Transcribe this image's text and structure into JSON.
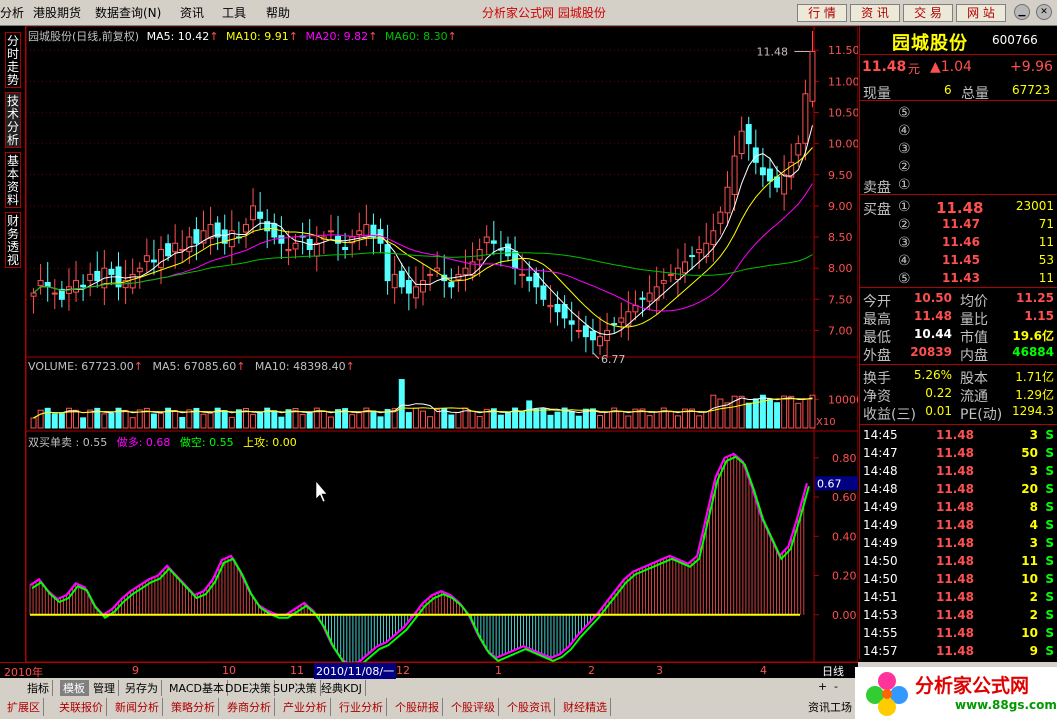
{
  "menu": {
    "items": [
      "分析",
      "港股期货",
      "数据查询(N)",
      "资讯",
      "工具",
      "帮助"
    ],
    "title": "分析家公式网  园城股份",
    "buttons": [
      "行 情",
      "资 讯",
      "交 易",
      "网 站"
    ]
  },
  "left_tabs": [
    "分时走势",
    "技术分析",
    "基本资料",
    "财务透视"
  ],
  "main_chart": {
    "header_name": "园城股份(日线,前复权)",
    "ma5": "MA5: 10.42",
    "ma10": "MA10: 9.91",
    "ma20": "MA20: 9.82",
    "ma60": "MA60: 8.30",
    "high_label": "11.48",
    "low_label": "6.77",
    "y_ticks": [
      "11.50",
      "11.00",
      "10.50",
      "10.00",
      "9.50",
      "9.00",
      "8.50",
      "8.00",
      "7.50",
      "7.00"
    ]
  },
  "volume_chart": {
    "volume": "VOLUME: 67723.00",
    "ma5": "MA5: 67085.60",
    "ma10": "MA10: 48398.40",
    "y_tick": "10000",
    "unit": "X10"
  },
  "indicator_chart": {
    "name": "双买单卖 : 0.55",
    "more": "做多: 0.68",
    "short": "做空: 0.55",
    "up": "上攻: 0.00",
    "y_ticks": [
      "0.80",
      "0.60",
      "0.40",
      "0.20",
      "0.00"
    ],
    "current": "0.67"
  },
  "chart_data": {
    "type": "candlestick",
    "title": "园城股份(日线,前复权)",
    "x_labels": [
      "2010年",
      "9",
      "10",
      "11",
      "2010/11/08/一",
      "12",
      "1",
      "2",
      "3",
      "4"
    ],
    "ylim": [
      6.75,
      11.6
    ],
    "high": 11.48,
    "low": 6.77,
    "ma": {
      "MA5": 10.42,
      "MA10": 9.91,
      "MA20": 9.82,
      "MA60": 8.3
    },
    "volume_ylim": [
      0,
      20000
    ],
    "indicator_ylim": [
      -0.2,
      0.85
    ],
    "close_series": [
      7.6,
      7.8,
      7.7,
      7.6,
      7.5,
      7.7,
      7.8,
      7.7,
      7.9,
      7.8,
      8.0,
      7.9,
      7.7,
      7.8,
      7.9,
      8.0,
      8.2,
      8.1,
      8.3,
      8.2,
      8.4,
      8.3,
      8.5,
      8.4,
      8.6,
      8.7,
      8.5,
      8.4,
      8.6,
      8.5,
      8.7,
      9.0,
      8.8,
      8.6,
      8.5,
      8.4,
      8.3,
      8.4,
      8.5,
      8.3,
      8.4,
      8.5,
      8.6,
      8.4,
      8.3,
      8.5,
      8.6,
      8.7,
      8.5,
      8.4,
      7.8,
      7.9,
      7.7,
      7.6,
      7.7,
      7.8,
      7.9,
      8.0,
      7.8,
      7.7,
      7.9,
      8.0,
      8.1,
      8.3,
      8.5,
      8.4,
      8.3,
      8.2,
      8.0,
      7.9,
      7.8,
      7.7,
      7.5,
      7.4,
      7.3,
      7.2,
      7.1,
      7.0,
      6.9,
      6.85,
      6.9,
      7.0,
      7.1,
      7.2,
      7.3,
      7.4,
      7.5,
      7.6,
      7.7,
      7.8,
      7.9,
      8.0,
      8.1,
      8.2,
      8.3,
      8.4,
      8.6,
      8.9,
      9.3,
      9.8,
      10.2,
      10.0,
      9.7,
      9.5,
      9.4,
      9.3,
      9.5,
      9.7,
      10.0,
      10.8,
      11.48
    ],
    "indicator_series": [
      0.15,
      0.18,
      0.12,
      0.08,
      0.1,
      0.16,
      0.14,
      0.05,
      0.0,
      0.03,
      0.08,
      0.12,
      0.15,
      0.18,
      0.2,
      0.25,
      0.2,
      0.15,
      0.1,
      0.12,
      0.18,
      0.28,
      0.3,
      0.22,
      0.12,
      0.05,
      0.02,
      0.0,
      0.0,
      0.03,
      0.06,
      0.02,
      -0.05,
      -0.15,
      -0.22,
      -0.26,
      -0.24,
      -0.2,
      -0.16,
      -0.14,
      -0.1,
      -0.06,
      0.0,
      0.06,
      0.1,
      0.12,
      0.1,
      0.06,
      0.0,
      -0.1,
      -0.18,
      -0.22,
      -0.2,
      -0.18,
      -0.16,
      -0.18,
      -0.2,
      -0.22,
      -0.2,
      -0.16,
      -0.1,
      -0.05,
      0.0,
      0.06,
      0.12,
      0.18,
      0.22,
      0.24,
      0.26,
      0.28,
      0.3,
      0.28,
      0.26,
      0.3,
      0.5,
      0.7,
      0.8,
      0.82,
      0.78,
      0.65,
      0.5,
      0.4,
      0.3,
      0.35,
      0.5,
      0.67
    ]
  },
  "right_panel": {
    "name": "园城股份",
    "code": "600766",
    "price": "11.48",
    "price_unit": "元",
    "change": "▲1.04",
    "change_pct": "+9.96",
    "xianliang_label": "现量",
    "xianliang": "6",
    "zongliang_label": "总量",
    "zongliang": "67723",
    "sell_label": "卖盘",
    "sell_levels": [
      "⑤",
      "④",
      "③",
      "②",
      "①"
    ],
    "buy_label": "买盘",
    "buy_levels": [
      {
        "level": "①",
        "price": "11.48",
        "vol": "23001"
      },
      {
        "level": "②",
        "price": "11.47",
        "vol": "71"
      },
      {
        "level": "③",
        "price": "11.46",
        "vol": "11"
      },
      {
        "level": "④",
        "price": "11.45",
        "vol": "53"
      },
      {
        "level": "⑤",
        "price": "11.43",
        "vol": "11"
      }
    ],
    "stats": [
      {
        "l1": "今开",
        "v1": "10.50",
        "l2": "均价",
        "v2": "11.25"
      },
      {
        "l1": "最高",
        "v1": "11.48",
        "l2": "量比",
        "v2": "1.15"
      },
      {
        "l1": "最低",
        "v1": "10.44",
        "l2": "市值",
        "v2": "19.6亿"
      },
      {
        "l1": "外盘",
        "v1": "20839",
        "l2": "内盘",
        "v2": "46884"
      }
    ],
    "stats2": [
      {
        "l1": "换手",
        "v1": "5.26%",
        "l2": "股本",
        "v2": "1.71亿"
      },
      {
        "l1": "净资",
        "v1": "0.22",
        "l2": "流通",
        "v2": "1.29亿"
      },
      {
        "l1": "收益(三)",
        "v1": "0.01",
        "l2": "PE(动)",
        "v2": "1294.3"
      }
    ],
    "ticks": [
      {
        "time": "14:45",
        "price": "11.48",
        "vol": "3",
        "bs": "S"
      },
      {
        "time": "14:47",
        "price": "11.48",
        "vol": "50",
        "bs": "S"
      },
      {
        "time": "14:48",
        "price": "11.48",
        "vol": "3",
        "bs": "S"
      },
      {
        "time": "14:48",
        "price": "11.48",
        "vol": "20",
        "bs": "S"
      },
      {
        "time": "14:49",
        "price": "11.48",
        "vol": "8",
        "bs": "S"
      },
      {
        "time": "14:49",
        "price": "11.48",
        "vol": "4",
        "bs": "S"
      },
      {
        "time": "14:49",
        "price": "11.48",
        "vol": "3",
        "bs": "S"
      },
      {
        "time": "14:50",
        "price": "11.48",
        "vol": "11",
        "bs": "S"
      },
      {
        "time": "14:50",
        "price": "11.48",
        "vol": "10",
        "bs": "S"
      },
      {
        "time": "14:51",
        "price": "11.48",
        "vol": "2",
        "bs": "S"
      },
      {
        "time": "14:53",
        "price": "11.48",
        "vol": "2",
        "bs": "S"
      },
      {
        "time": "14:55",
        "price": "11.48",
        "vol": "10",
        "bs": "S"
      },
      {
        "time": "14:57",
        "price": "11.48",
        "vol": "9",
        "bs": "S"
      }
    ]
  },
  "bottom": {
    "period": "日线",
    "tabs": [
      "指标",
      "模板",
      "管理",
      "另存为",
      "MACD基本",
      "DDE决策",
      "SUP决策",
      "经典KDJ"
    ],
    "func_tabs": [
      "扩展区",
      "关联报价",
      "新闻分析",
      "策略分析",
      "券商分析",
      "产业分析",
      "行业分析",
      "个股研报",
      "个股评级",
      "个股资讯",
      "财经精选"
    ],
    "right_tab": "资讯工场",
    "logo_text": "分析家公式网",
    "logo_url": "www.88gs.com"
  },
  "colors": {
    "up": "#ff5050",
    "down": "#54ffff",
    "ma5": "#ffffff",
    "ma10": "#ffff00",
    "ma20": "#ff00ff",
    "ma60": "#00c000",
    "grid": "#b00000"
  }
}
